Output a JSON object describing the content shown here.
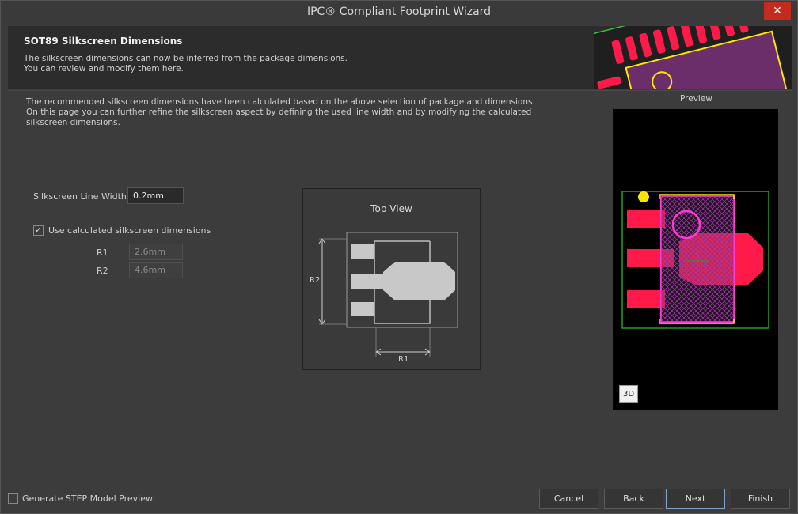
{
  "window": {
    "title": "IPC® Compliant Footprint Wizard",
    "close_glyph": "✕"
  },
  "header": {
    "title": "SOT89 Silkscreen Dimensions",
    "subtitle_line1": "The silkscreen dimensions can now be inferred from the package dimensions.",
    "subtitle_line2": "You can review and modify them here."
  },
  "description": "The recommended silkscreen dimensions have been calculated based on the above selection of package and dimensions. On this page you can further refine the silkscreen aspect by defining the used line width and by modifying the calculated silkscreen dimensions.",
  "form": {
    "line_width_label": "Silkscreen Line Width",
    "line_width_value": "0.2mm",
    "use_calc_label": "Use calculated silkscreen dimensions",
    "use_calc_checked": "✓",
    "r1_label": "R1",
    "r1_value": "2.6mm",
    "r2_label": "R2",
    "r2_value": "4.6mm"
  },
  "diagram": {
    "title": "Top View",
    "r1": "R1",
    "r2": "R2"
  },
  "preview": {
    "label": "Preview",
    "btn_3d": "3D"
  },
  "footer": {
    "step_preview_label": "Generate STEP Model Preview",
    "cancel": "Cancel",
    "back": "Back",
    "next": "Next",
    "finish": "Finish"
  },
  "colors": {
    "pad": "#ff1a4a",
    "silk": "#ffe600",
    "courtyard": "#1fa31f",
    "body_outline": "#ff3bd4"
  }
}
